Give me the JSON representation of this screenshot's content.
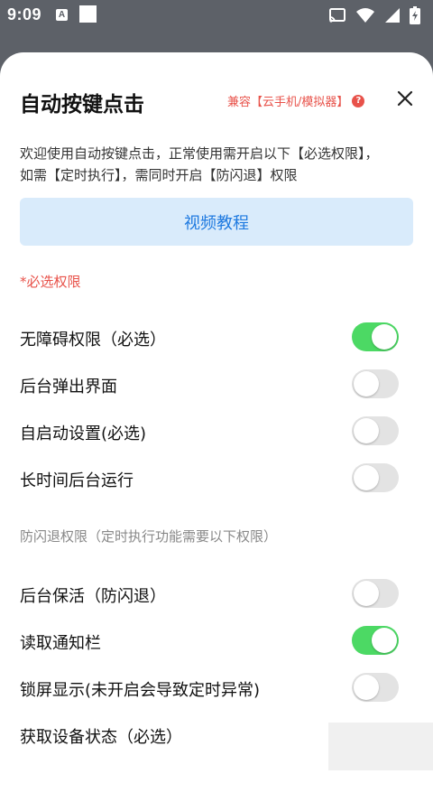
{
  "status_bar": {
    "time": "9:09",
    "notification_letter": "A"
  },
  "dialog": {
    "title": "自动按键点击",
    "compat_label": "兼容【云手机/模拟器】",
    "help_symbol": "?",
    "intro": "欢迎使用自动按键点击，正常使用需开启以下【必选权限】，如需【定时执行】，需同时开启【防闪退】权限",
    "video_button": "视频教程",
    "required_section_label": "*必选权限",
    "antiflash_section_label": "防闪退权限（定时执行功能需要以下权限）",
    "required_permissions": [
      {
        "label": "无障碍权限（必选）",
        "enabled": true
      },
      {
        "label": "后台弹出界面",
        "enabled": false
      },
      {
        "label": "自启动设置(必选)",
        "enabled": false
      },
      {
        "label": "长时间后台运行",
        "enabled": false
      }
    ],
    "antiflash_permissions": [
      {
        "label": "后台保活（防闪退）",
        "enabled": false
      },
      {
        "label": "读取通知栏",
        "enabled": true
      },
      {
        "label": "锁屏显示(未开启会导致定时异常)",
        "enabled": false
      },
      {
        "label": "获取设备状态（必选）",
        "enabled": null
      }
    ]
  },
  "colors": {
    "accent_red": "#e8524a",
    "accent_blue": "#1f7ae0",
    "toggle_on": "#4cd964",
    "toggle_off": "#e3e3e3",
    "backdrop": "#5d6168"
  }
}
